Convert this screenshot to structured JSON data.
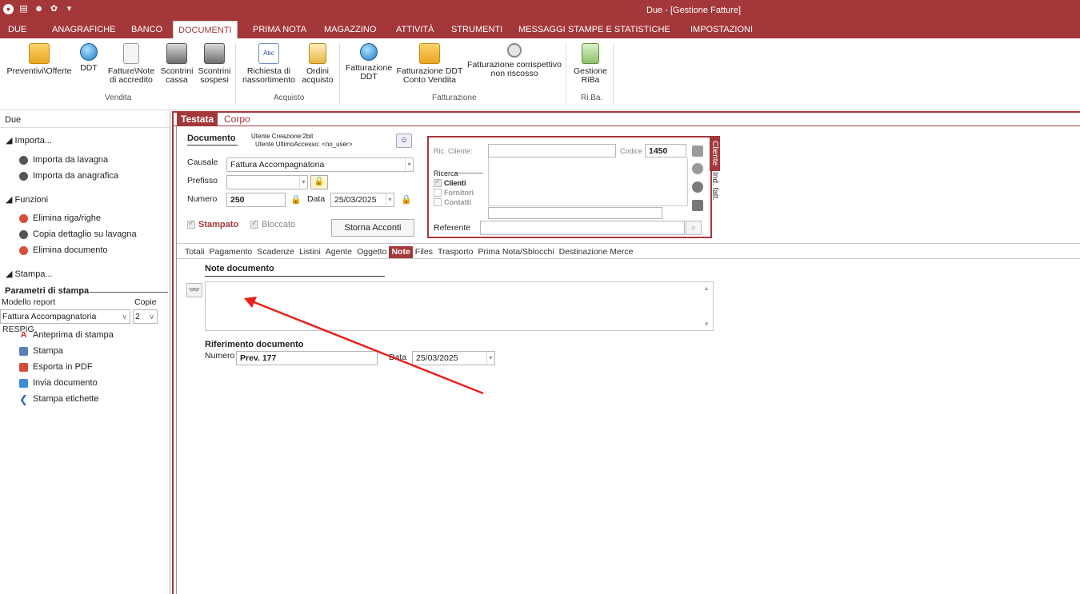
{
  "window": {
    "title": "Due - [Gestione Fatture]"
  },
  "quick_access": [
    "app-logo-icon",
    "save-icon",
    "users-icon",
    "settings-icon",
    "dropdown-icon"
  ],
  "menu": {
    "tabs": [
      {
        "label": "DUE"
      },
      {
        "label": "ANAGRAFICHE"
      },
      {
        "label": "BANCO"
      },
      {
        "label": "DOCUMENTI",
        "active": true
      },
      {
        "label": "PRIMA NOTA"
      },
      {
        "label": "MAGAZZINO"
      },
      {
        "label": "ATTIVITÀ"
      },
      {
        "label": "STRUMENTI"
      },
      {
        "label": "MESSAGGI"
      },
      {
        "label": "STAMPE E STATISTICHE"
      },
      {
        "label": "IMPOSTAZIONI"
      }
    ]
  },
  "ribbon": {
    "buttons": [
      {
        "line1": "Preventivi\\Offerte",
        "line2": "",
        "icon": "folder-icon"
      },
      {
        "line1": "DDT",
        "line2": "",
        "icon": "globe-icon"
      },
      {
        "line1": "Fatture\\Note",
        "line2": "di accredito",
        "icon": "document-icon"
      },
      {
        "line1": "Scontrini",
        "line2": "cassa",
        "icon": "printer-icon"
      },
      {
        "line1": "Scontrini",
        "line2": "sospesi",
        "icon": "printer-icon"
      },
      {
        "line1": "Richiesta di",
        "line2": "riassortimento",
        "icon": "abc-icon"
      },
      {
        "line1": "Ordini",
        "line2": "acquisto",
        "icon": "box-icon"
      },
      {
        "line1": "Fatturazione",
        "line2": "DDT",
        "icon": "globe-icon"
      },
      {
        "line1": "Fatturazione DDT",
        "line2": "Conto Vendita",
        "icon": "folder-icon"
      },
      {
        "line1": "Fatturazione corrispettivo",
        "line2": "non riscosso",
        "icon": "gear-icon"
      },
      {
        "line1": "Gestione",
        "line2": "RiBa",
        "icon": "riba-icon"
      }
    ],
    "groups": [
      "Vendita",
      "Acquisto",
      "Fatturazione",
      "Ri.Ba."
    ]
  },
  "sidebar": {
    "title": "Due",
    "sections": {
      "importa": "Importa...",
      "funzioni": "Funzioni",
      "stampa": "Stampa..."
    },
    "importa_items": [
      "Importa da lavagna",
      "Importa da anagrafica"
    ],
    "funzioni_items": [
      "Elimina riga/righe",
      "Copia dettaglio su lavagna",
      "Elimina documento"
    ],
    "params": {
      "header": "Parametri di stampa",
      "model_label": "Modello report",
      "copies_label": "Copie",
      "model_value": "Fattura Accompagnatoria RESPIG",
      "copies_value": "2"
    },
    "print_items": [
      "Anteprima di stampa",
      "Stampa",
      "Esporta in PDF",
      "Invia documento",
      "Stampa etichette"
    ]
  },
  "main": {
    "tabs": {
      "testata": "Testata",
      "corpo": "Corpo"
    },
    "documento": {
      "header": "Documento",
      "utente_creazione": "Utente Creazione:2bit",
      "utente_accesso": "Utente UltimoAccesso: <no_user>",
      "causale_label": "Causale",
      "causale_value": "Fattura Accompagnatoria",
      "prefisso_label": "Prefisso",
      "prefisso_value": "",
      "numero_label": "Numero",
      "numero_value": "250",
      "data_label": "Data",
      "data_value": "25/03/2025",
      "stampato": "Stampato",
      "bloccato": "Bloccato",
      "storna_button": "Storna Acconti"
    },
    "cliente": {
      "ric_label": "Ric. Cliente:",
      "codice_label": "Codice",
      "codice_value": "1450",
      "ricerca_label": "Ricerca",
      "opt_clienti": "Clienti",
      "opt_fornitori": "Fornitori",
      "opt_contatti": "Contatti",
      "referente_label": "Referente",
      "tab_cliente": "Cliente",
      "tab_ind": "Ind. fatt."
    },
    "subtabs": [
      {
        "label": "Totali"
      },
      {
        "label": "Pagamento"
      },
      {
        "label": "Scadenze"
      },
      {
        "label": "Listini"
      },
      {
        "label": "Agente"
      },
      {
        "label": "Oggetto"
      },
      {
        "label": "Note",
        "active": true
      },
      {
        "label": "Files"
      },
      {
        "label": "Trasporto"
      },
      {
        "label": "Prima Nota/Sblocchi"
      },
      {
        "label": "Destinazione Merce"
      }
    ],
    "note": {
      "header": "Note documento",
      "text": ""
    },
    "riferimento": {
      "header": "Riferimento documento",
      "numero_label": "Numero",
      "numero_value": "Prev. 177",
      "data_label": "Data",
      "data_value": "25/03/2025"
    }
  },
  "colors": {
    "accent": "#a4373a",
    "arrow": "#e8201c"
  }
}
